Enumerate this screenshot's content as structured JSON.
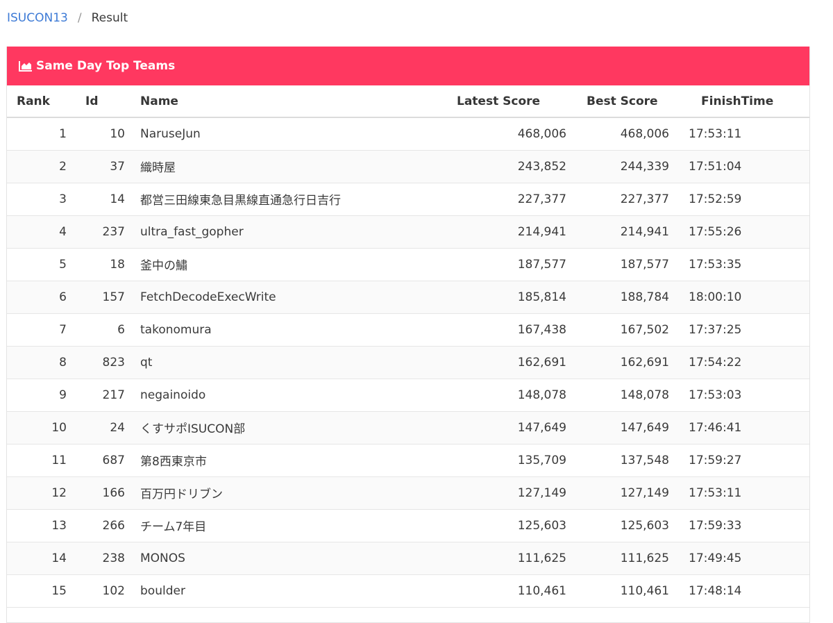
{
  "breadcrumb": {
    "home": "ISUCON13",
    "separator": "/",
    "current": "Result"
  },
  "card": {
    "title": "Same Day Top Teams",
    "icon": "area-chart-icon",
    "header_color": "#ff3860"
  },
  "table": {
    "columns": [
      "Rank",
      "Id",
      "Name",
      "Latest Score",
      "Best Score",
      "FinishTime"
    ],
    "rows": [
      [
        "1",
        "10",
        "NaruseJun",
        "468,006",
        "468,006",
        "17:53:11"
      ],
      [
        "2",
        "37",
        "織時屋",
        "243,852",
        "244,339",
        "17:51:04"
      ],
      [
        "3",
        "14",
        "都営三田線東急目黒線直通急行日吉行",
        "227,377",
        "227,377",
        "17:52:59"
      ],
      [
        "4",
        "237",
        "ultra_fast_gopher",
        "214,941",
        "214,941",
        "17:55:26"
      ],
      [
        "5",
        "18",
        "釜中の鱐",
        "187,577",
        "187,577",
        "17:53:35"
      ],
      [
        "6",
        "157",
        "FetchDecodeExecWrite",
        "185,814",
        "188,784",
        "18:00:10"
      ],
      [
        "7",
        "6",
        "takonomura",
        "167,438",
        "167,502",
        "17:37:25"
      ],
      [
        "8",
        "823",
        "qt",
        "162,691",
        "162,691",
        "17:54:22"
      ],
      [
        "9",
        "217",
        "negainoido",
        "148,078",
        "148,078",
        "17:53:03"
      ],
      [
        "10",
        "24",
        "くすサポISUCON部",
        "147,649",
        "147,649",
        "17:46:41"
      ],
      [
        "11",
        "687",
        "第8西東京市",
        "135,709",
        "137,548",
        "17:59:27"
      ],
      [
        "12",
        "166",
        "百万円ドリブン",
        "127,149",
        "127,149",
        "17:53:11"
      ],
      [
        "13",
        "266",
        "チーム7年目",
        "125,603",
        "125,603",
        "17:59:33"
      ],
      [
        "14",
        "238",
        "MONOS",
        "111,625",
        "111,625",
        "17:49:45"
      ],
      [
        "15",
        "102",
        "boulder",
        "110,461",
        "110,461",
        "17:48:14"
      ]
    ]
  }
}
